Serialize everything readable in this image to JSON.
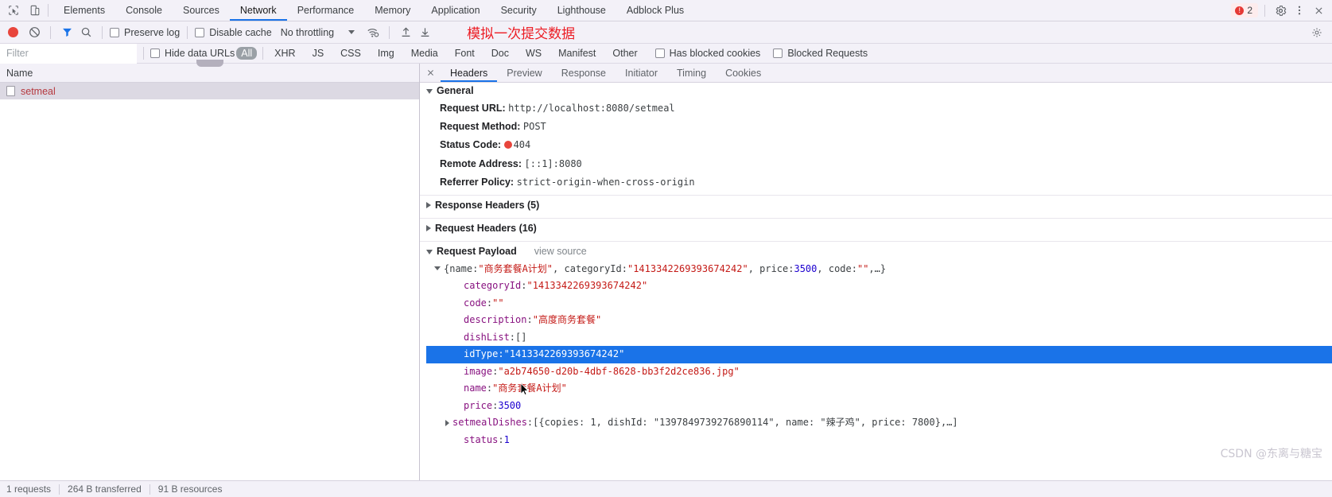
{
  "tabbar": {
    "icons": [
      {
        "name": "inspect-element-icon"
      },
      {
        "name": "device-toolbar-icon"
      }
    ],
    "tabs": [
      {
        "label": "Elements",
        "active": false
      },
      {
        "label": "Console",
        "active": false
      },
      {
        "label": "Sources",
        "active": false
      },
      {
        "label": "Network",
        "active": true
      },
      {
        "label": "Performance",
        "active": false
      },
      {
        "label": "Memory",
        "active": false
      },
      {
        "label": "Application",
        "active": false
      },
      {
        "label": "Security",
        "active": false
      },
      {
        "label": "Lighthouse",
        "active": false
      },
      {
        "label": "Adblock Plus",
        "active": false
      }
    ],
    "error_count": "2",
    "settings_label": "gear-icon",
    "more_label": "kebab-menu-icon",
    "close_label": "close-icon"
  },
  "network_toolbar": {
    "record_title": "record-button",
    "clear_title": "clear-button",
    "filter_title": "filter-icon",
    "search_title": "search-icon",
    "preserve_log": "Preserve log",
    "disable_cache": "Disable cache",
    "throttling": "No throttling",
    "wifi_title": "network-conditions-icon",
    "import_title": "import-har-icon",
    "export_title": "export-har-icon",
    "annotation": "模拟一次提交数据",
    "settings_title": "network-settings-icon"
  },
  "filterbar": {
    "filter_placeholder": "Filter",
    "filter_value": "",
    "hide_data_urls": "Hide data URLs",
    "types": [
      {
        "label": "All",
        "active": true
      },
      {
        "label": "XHR",
        "active": false
      },
      {
        "label": "JS",
        "active": false
      },
      {
        "label": "CSS",
        "active": false
      },
      {
        "label": "Img",
        "active": false
      },
      {
        "label": "Media",
        "active": false
      },
      {
        "label": "Font",
        "active": false
      },
      {
        "label": "Doc",
        "active": false
      },
      {
        "label": "WS",
        "active": false
      },
      {
        "label": "Manifest",
        "active": false
      },
      {
        "label": "Other",
        "active": false
      }
    ],
    "has_blocked_cookies": "Has blocked cookies",
    "blocked_requests": "Blocked Requests"
  },
  "requests_pane": {
    "column_header": "Name",
    "rows": [
      {
        "name": "setmeal",
        "error": true
      }
    ]
  },
  "detail_tabs": [
    {
      "label": "Headers",
      "active": true
    },
    {
      "label": "Preview",
      "active": false
    },
    {
      "label": "Response",
      "active": false
    },
    {
      "label": "Initiator",
      "active": false
    },
    {
      "label": "Timing",
      "active": false
    },
    {
      "label": "Cookies",
      "active": false
    }
  ],
  "general": {
    "title": "General",
    "items": [
      {
        "key": "Request URL:",
        "value": "http://localhost:8080/setmeal",
        "status": false
      },
      {
        "key": "Request Method:",
        "value": "POST",
        "status": false
      },
      {
        "key": "Status Code:",
        "value": "404",
        "status": true
      },
      {
        "key": "Remote Address:",
        "value": "[::1]:8080",
        "status": false
      },
      {
        "key": "Referrer Policy:",
        "value": "strict-origin-when-cross-origin",
        "status": false
      }
    ]
  },
  "sections": {
    "response_headers": "Response Headers (5)",
    "request_headers": "Request Headers (16)",
    "request_payload": "Request Payload",
    "view_source": "view source"
  },
  "payload": {
    "summary": {
      "prefix": "{name: ",
      "name_value": "\"商务套餐A计划\"",
      "mid1": ", categoryId: ",
      "category_value": "\"1413342269393674242\"",
      "mid2": ", price: ",
      "price_value": "3500",
      "mid3": ", code: ",
      "code_value": "\"\"",
      "suffix": ",…}"
    },
    "rows": [
      {
        "key": "categoryId",
        "sep": ": ",
        "value": "\"1413342269393674242\"",
        "vtype": "str",
        "expand": "none",
        "selected": false
      },
      {
        "key": "code",
        "sep": ": ",
        "value": "\"\"",
        "vtype": "str",
        "expand": "none",
        "selected": false
      },
      {
        "key": "description",
        "sep": ": ",
        "value": "\"高度商务套餐\"",
        "vtype": "str",
        "expand": "none",
        "selected": false
      },
      {
        "key": "dishList",
        "sep": ": ",
        "value": "[]",
        "vtype": "punct",
        "expand": "none",
        "selected": false
      },
      {
        "key": "idType",
        "sep": ": ",
        "value": "\"1413342269393674242\"",
        "vtype": "str",
        "expand": "none",
        "selected": true
      },
      {
        "key": "image",
        "sep": ": ",
        "value": "\"a2b74650-d20b-4dbf-8628-bb3f2d2ce836.jpg\"",
        "vtype": "str",
        "expand": "none",
        "selected": false
      },
      {
        "key": "name",
        "sep": ": ",
        "value": "\"商务套餐A计划\"",
        "vtype": "str",
        "expand": "none",
        "selected": false
      },
      {
        "key": "price",
        "sep": ": ",
        "value": "3500",
        "vtype": "num",
        "expand": "none",
        "selected": false
      },
      {
        "key": "setmealDishes",
        "sep": ": ",
        "value": "[{copies: 1, dishId: \"1397849739276890114\", name: \"辣子鸡\", price: 7800},…]",
        "vtype": "punct",
        "expand": "right",
        "selected": false
      },
      {
        "key": "status",
        "sep": ": ",
        "value": "1",
        "vtype": "num",
        "expand": "none",
        "selected": false
      }
    ]
  },
  "statusbar": {
    "requests": "1 requests",
    "transferred": "264 B transferred",
    "resources": "91 B resources"
  },
  "watermark": "CSDN @东离与糖宝",
  "colors": {
    "accent": "#1a73e8",
    "error": "#e8453c",
    "annotation": "#ec1c24",
    "selection": "#1a73e8"
  }
}
